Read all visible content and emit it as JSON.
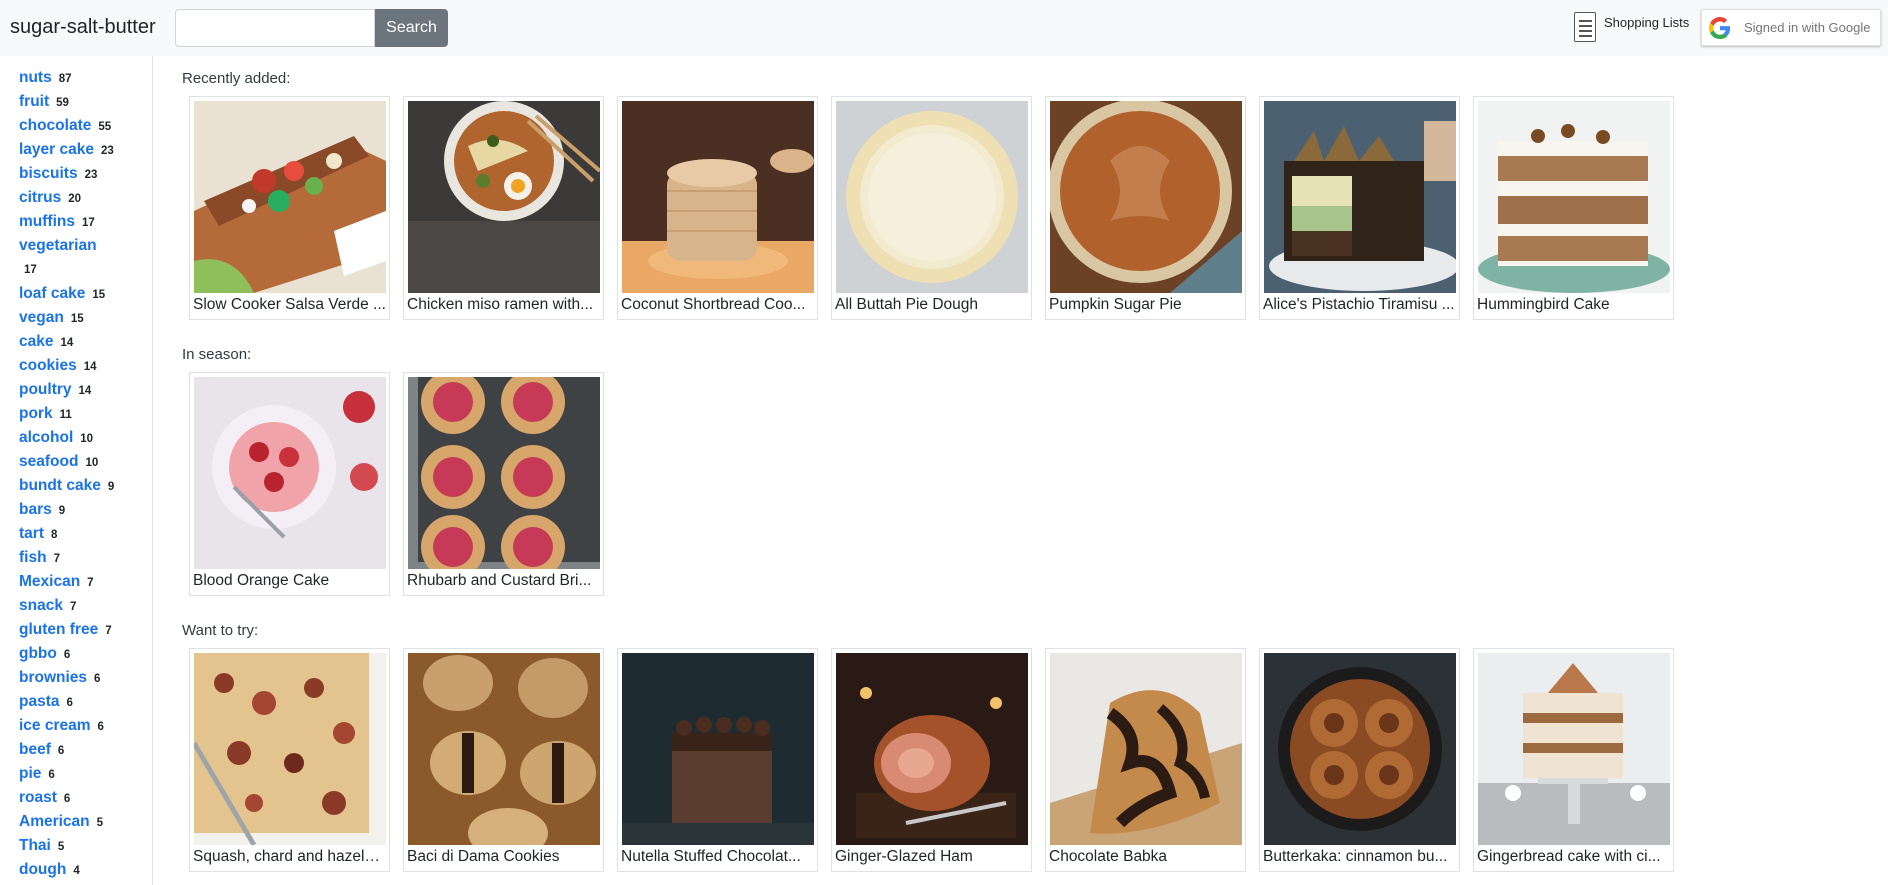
{
  "header": {
    "brand": "sugar-salt-butter",
    "search_value": "",
    "search_button": "Search",
    "shopping_label": "Shopping Lists",
    "google_label": "Signed in with Google"
  },
  "sidebar": {
    "tags": [
      {
        "name": "nuts",
        "count": "87"
      },
      {
        "name": "fruit",
        "count": "59"
      },
      {
        "name": "chocolate",
        "count": "55"
      },
      {
        "name": "layer cake",
        "count": "23"
      },
      {
        "name": "biscuits",
        "count": "23"
      },
      {
        "name": "citrus",
        "count": "20"
      },
      {
        "name": "muffins",
        "count": "17"
      },
      {
        "name": "vegetarian",
        "count": "17"
      },
      {
        "name": "loaf cake",
        "count": "15"
      },
      {
        "name": "vegan",
        "count": "15"
      },
      {
        "name": "cake",
        "count": "14"
      },
      {
        "name": "cookies",
        "count": "14"
      },
      {
        "name": "poultry",
        "count": "14"
      },
      {
        "name": "pork",
        "count": "11"
      },
      {
        "name": "alcohol",
        "count": "10"
      },
      {
        "name": "seafood",
        "count": "10"
      },
      {
        "name": "bundt cake",
        "count": "9"
      },
      {
        "name": "bars",
        "count": "9"
      },
      {
        "name": "tart",
        "count": "8"
      },
      {
        "name": "fish",
        "count": "7"
      },
      {
        "name": "Mexican",
        "count": "7"
      },
      {
        "name": "snack",
        "count": "7"
      },
      {
        "name": "gluten free",
        "count": "7"
      },
      {
        "name": "gbbo",
        "count": "6"
      },
      {
        "name": "brownies",
        "count": "6"
      },
      {
        "name": "pasta",
        "count": "6"
      },
      {
        "name": "ice cream",
        "count": "6"
      },
      {
        "name": "beef",
        "count": "6"
      },
      {
        "name": "pie",
        "count": "6"
      },
      {
        "name": "roast",
        "count": "6"
      },
      {
        "name": "American",
        "count": "5"
      },
      {
        "name": "Thai",
        "count": "5"
      },
      {
        "name": "dough",
        "count": "4"
      }
    ]
  },
  "sections": {
    "recent": {
      "title": "Recently added:",
      "cards": [
        {
          "title": "Slow Cooker Salsa Verde ...",
          "image": "tacos-photo"
        },
        {
          "title": "Chicken miso ramen with...",
          "image": "ramen-photo"
        },
        {
          "title": "Coconut Shortbread Coo...",
          "image": "shortbread-photo"
        },
        {
          "title": "All Buttah Pie Dough",
          "image": "pie-dough-photo"
        },
        {
          "title": "Pumpkin Sugar Pie",
          "image": "pumpkin-pie-photo"
        },
        {
          "title": "Alice's Pistachio Tiramisu ...",
          "image": "tiramisu-cake-photo"
        },
        {
          "title": "Hummingbird Cake",
          "image": "hummingbird-cake-photo"
        }
      ]
    },
    "season": {
      "title": "In season:",
      "cards": [
        {
          "title": "Blood Orange Cake",
          "image": "blood-orange-cake-photo"
        },
        {
          "title": "Rhubarb and Custard Bri...",
          "image": "rhubarb-brioche-photo"
        }
      ]
    },
    "want": {
      "title": "Want to try:",
      "cards": [
        {
          "title": "Squash, chard and hazeln...",
          "image": "squash-bake-photo"
        },
        {
          "title": "Baci di Dama Cookies",
          "image": "baci-cookies-photo"
        },
        {
          "title": "Nutella Stuffed Chocolat...",
          "image": "nutella-cake-photo"
        },
        {
          "title": "Ginger-Glazed Ham",
          "image": "ham-photo"
        },
        {
          "title": "Chocolate Babka",
          "image": "babka-photo"
        },
        {
          "title": "Butterkaka: cinnamon bu...",
          "image": "butterkaka-photo"
        },
        {
          "title": "Gingerbread cake with ci...",
          "image": "gingerbread-cake-photo"
        }
      ]
    }
  },
  "colors": {
    "link": "#1a73e8",
    "search_button": "#6c757d",
    "topbar": "#f8f9fa"
  }
}
